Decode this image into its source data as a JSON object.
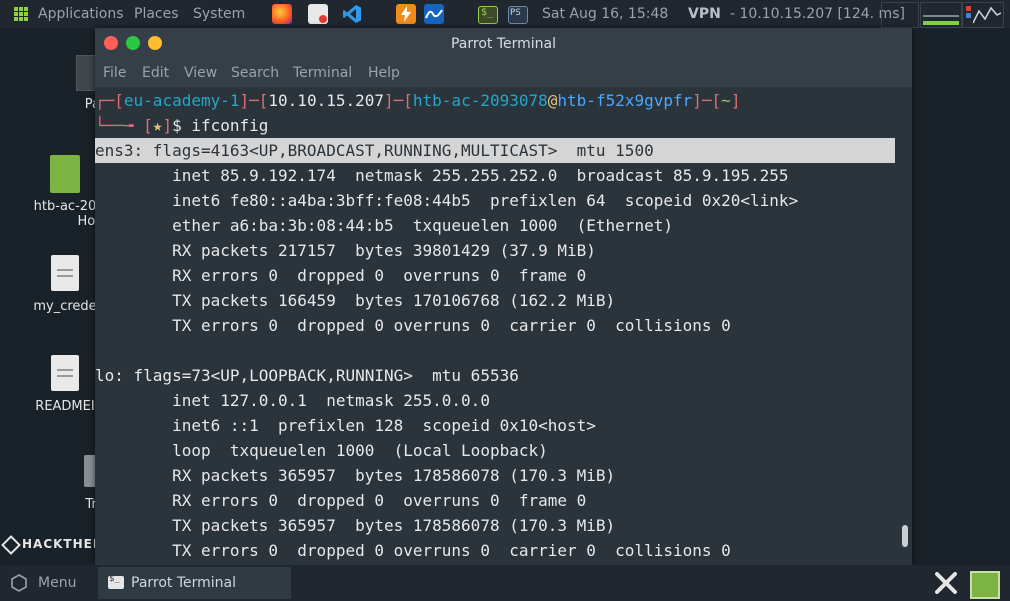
{
  "top_panel": {
    "applications": "Applications",
    "places": "Places",
    "system": "System",
    "clock": "Sat Aug 16, 15:48",
    "vpn_label": "VPN",
    "vpn_value": "- 10.10.15.207 [124. ms]"
  },
  "desktop": {
    "icons": [
      {
        "label": "Par"
      },
      {
        "label": "htb-ac-20"
      },
      {
        "label": "Hor"
      },
      {
        "label": "my_crede"
      },
      {
        "label": "READMEI"
      },
      {
        "label": "Tra"
      }
    ],
    "htb_logo": "HACKTHEB"
  },
  "window": {
    "title": "Parrot Terminal",
    "menu": [
      "File",
      "Edit",
      "View",
      "Search",
      "Terminal",
      "Help"
    ]
  },
  "terminal": {
    "prompt": {
      "user": "eu-academy-1",
      "ip": "10.10.15.207",
      "login": "htb-ac-2093078",
      "host": "htb-f52x9gvpfr",
      "dir": "~",
      "star": "★",
      "command": "ifconfig"
    },
    "lines": [
      "ens3: flags=4163<UP,BROADCAST,RUNNING,MULTICAST>  mtu 1500",
      "        inet 85.9.192.174  netmask 255.255.252.0  broadcast 85.9.195.255",
      "        inet6 fe80::a4ba:3bff:fe08:44b5  prefixlen 64  scopeid 0x20<link>",
      "        ether a6:ba:3b:08:44:b5  txqueuelen 1000  (Ethernet)",
      "        RX packets 217157  bytes 39801429 (37.9 MiB)",
      "        RX errors 0  dropped 0  overruns 0  frame 0",
      "        TX packets 166459  bytes 170106768 (162.2 MiB)",
      "        TX errors 0  dropped 0 overruns 0  carrier 0  collisions 0",
      "",
      "lo: flags=73<UP,LOOPBACK,RUNNING>  mtu 65536",
      "        inet 127.0.0.1  netmask 255.0.0.0",
      "        inet6 ::1  prefixlen 128  scopeid 0x10<host>",
      "        loop  txqueuelen 1000  (Local Loopback)",
      "        RX packets 365957  bytes 178586078 (170.3 MiB)",
      "        RX errors 0  dropped 0  overruns 0  frame 0",
      "        TX packets 365957  bytes 178586078 (170.3 MiB)",
      "        TX errors 0  dropped 0 overruns 0  carrier 0  collisions 0"
    ]
  },
  "bottom_panel": {
    "menu": "Menu",
    "task": "Parrot Terminal"
  }
}
